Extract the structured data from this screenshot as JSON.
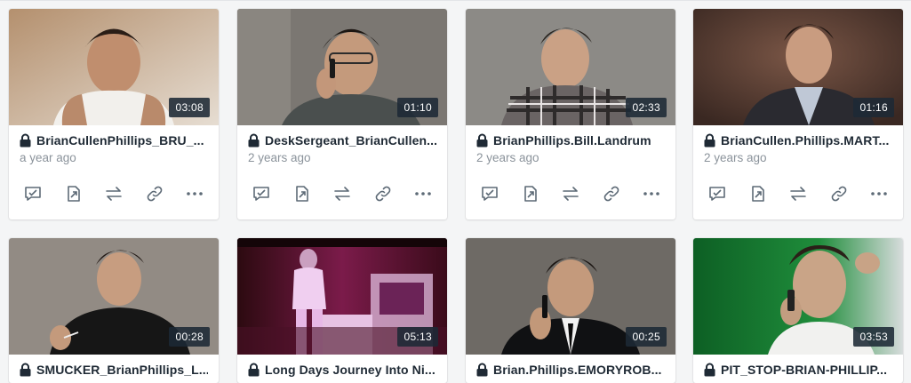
{
  "videos": [
    {
      "title": "BrianCullenPhillips_BRU_...",
      "age": "a year ago",
      "duration": "03:08",
      "icon": "lock-icon",
      "thumb_colors": [
        "#c9a07a",
        "#7a5a44",
        "#e8e2d8"
      ]
    },
    {
      "title": "DeskSergeant_BrianCullen...",
      "age": "2 years ago",
      "duration": "01:10",
      "icon": "lock-icon",
      "thumb_colors": [
        "#7d7a74",
        "#55524d",
        "#3e4446"
      ]
    },
    {
      "title": "BrianPhillips.Bill.Landrum",
      "age": "2 years ago",
      "duration": "02:33",
      "icon": "lock-icon",
      "thumb_colors": [
        "#8c8b87",
        "#6a6864",
        "#5d5b58"
      ]
    },
    {
      "title": "BrianCullen.Phillips.MART...",
      "age": "2 years ago",
      "duration": "01:16",
      "icon": "lock-icon",
      "thumb_colors": [
        "#6a4a3b",
        "#3c2a24",
        "#bfc6d2"
      ]
    },
    {
      "title": "SMUCKER_BrianPhillips_L...",
      "age": "",
      "duration": "00:28",
      "icon": "lock-icon",
      "thumb_colors": [
        "#918a83",
        "#6e6963",
        "#1b1b1b"
      ]
    },
    {
      "title": "Long Days Journey Into Ni...",
      "age": "",
      "duration": "05:13",
      "icon": "lock-icon",
      "thumb_colors": [
        "#3a0d14",
        "#a0246a",
        "#e3bde8"
      ]
    },
    {
      "title": "Brian.Phillips.EMORYROB...",
      "age": "",
      "duration": "00:25",
      "icon": "lock-icon",
      "thumb_colors": [
        "#6f6b66",
        "#4b4845",
        "#121315"
      ]
    },
    {
      "title": "PIT_STOP-BRIAN-PHILLIP...",
      "age": "",
      "duration": "03:53",
      "icon": "lock-icon",
      "thumb_colors": [
        "#1f8a3a",
        "#0f5a24",
        "#c9cfd0"
      ]
    }
  ],
  "actions": [
    {
      "name": "review-icon"
    },
    {
      "name": "share-icon"
    },
    {
      "name": "replace-icon"
    },
    {
      "name": "link-icon"
    },
    {
      "name": "more-icon"
    }
  ]
}
